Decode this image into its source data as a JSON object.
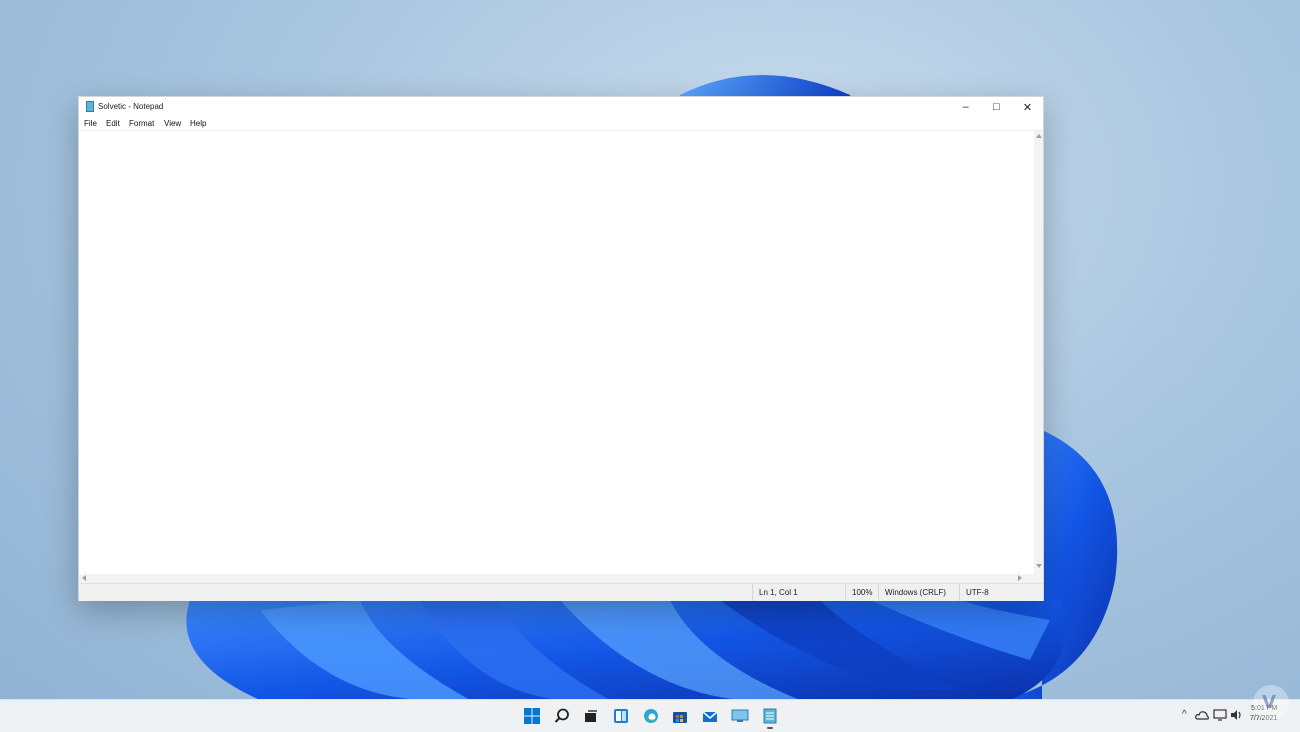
{
  "window": {
    "title": "Solvetic - Notepad",
    "controls": {
      "minimize": "–",
      "maximize": "□",
      "close": "✕"
    }
  },
  "menu": [
    "File",
    "Edit",
    "Format",
    "View",
    "Help"
  ],
  "editor": {
    "text": ""
  },
  "status": {
    "position": "Ln 1, Col 1",
    "zoom": "100%",
    "line_ending": "Windows (CRLF)",
    "encoding": "UTF-8"
  },
  "taskbar": {
    "icons": [
      "start-icon",
      "search-icon",
      "task-view-icon",
      "widgets-icon",
      "edge-icon",
      "store-icon",
      "mail-icon",
      "remote-desktop-icon",
      "notepad-icon"
    ],
    "tray": {
      "chevron": "^",
      "time": "5:01 PM",
      "date": "7/7/2021"
    }
  },
  "colors": {
    "accent": "#0067c0",
    "wallpaper": "#1a5cff"
  }
}
